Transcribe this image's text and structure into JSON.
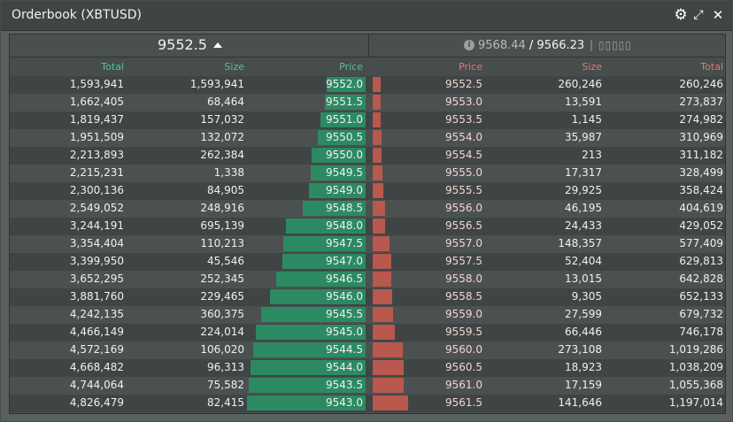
{
  "window": {
    "title": "Orderbook (XBTUSD)"
  },
  "header": {
    "last_price": "9552.5",
    "mark_price": "9568.44",
    "separator": " / ",
    "index_price": "9566.23",
    "funding_placeholder": "| ▯▯▯▯▯"
  },
  "columns": {
    "bid_total": "Total",
    "bid_size": "Size",
    "bid_price": "Price",
    "ask_price": "Price",
    "ask_size": "Size",
    "ask_total": "Total"
  },
  "colors": {
    "bid": "#2c8a62",
    "ask": "#b9584d",
    "bid_text": "#53c48f",
    "ask_text": "#e07a6e"
  },
  "max_total": 4826479,
  "rows": [
    {
      "bid_total": "1,593,941",
      "bid_size": "1,593,941",
      "bid_price": "9552.0",
      "ask_price": "9552.5",
      "ask_size": "260,246",
      "ask_total": "260,246"
    },
    {
      "bid_total": "1,662,405",
      "bid_size": "68,464",
      "bid_price": "9551.5",
      "ask_price": "9553.0",
      "ask_size": "13,591",
      "ask_total": "273,837"
    },
    {
      "bid_total": "1,819,437",
      "bid_size": "157,032",
      "bid_price": "9551.0",
      "ask_price": "9553.5",
      "ask_size": "1,145",
      "ask_total": "274,982"
    },
    {
      "bid_total": "1,951,509",
      "bid_size": "132,072",
      "bid_price": "9550.5",
      "ask_price": "9554.0",
      "ask_size": "35,987",
      "ask_total": "310,969"
    },
    {
      "bid_total": "2,213,893",
      "bid_size": "262,384",
      "bid_price": "9550.0",
      "ask_price": "9554.5",
      "ask_size": "213",
      "ask_total": "311,182"
    },
    {
      "bid_total": "2,215,231",
      "bid_size": "1,338",
      "bid_price": "9549.5",
      "ask_price": "9555.0",
      "ask_size": "17,317",
      "ask_total": "328,499"
    },
    {
      "bid_total": "2,300,136",
      "bid_size": "84,905",
      "bid_price": "9549.0",
      "ask_price": "9555.5",
      "ask_size": "29,925",
      "ask_total": "358,424"
    },
    {
      "bid_total": "2,549,052",
      "bid_size": "248,916",
      "bid_price": "9548.5",
      "ask_price": "9556.0",
      "ask_size": "46,195",
      "ask_total": "404,619"
    },
    {
      "bid_total": "3,244,191",
      "bid_size": "695,139",
      "bid_price": "9548.0",
      "ask_price": "9556.5",
      "ask_size": "24,433",
      "ask_total": "429,052"
    },
    {
      "bid_total": "3,354,404",
      "bid_size": "110,213",
      "bid_price": "9547.5",
      "ask_price": "9557.0",
      "ask_size": "148,357",
      "ask_total": "577,409"
    },
    {
      "bid_total": "3,399,950",
      "bid_size": "45,546",
      "bid_price": "9547.0",
      "ask_price": "9557.5",
      "ask_size": "52,404",
      "ask_total": "629,813"
    },
    {
      "bid_total": "3,652,295",
      "bid_size": "252,345",
      "bid_price": "9546.5",
      "ask_price": "9558.0",
      "ask_size": "13,015",
      "ask_total": "642,828"
    },
    {
      "bid_total": "3,881,760",
      "bid_size": "229,465",
      "bid_price": "9546.0",
      "ask_price": "9558.5",
      "ask_size": "9,305",
      "ask_total": "652,133"
    },
    {
      "bid_total": "4,242,135",
      "bid_size": "360,375",
      "bid_price": "9545.5",
      "ask_price": "9559.0",
      "ask_size": "27,599",
      "ask_total": "679,732"
    },
    {
      "bid_total": "4,466,149",
      "bid_size": "224,014",
      "bid_price": "9545.0",
      "ask_price": "9559.5",
      "ask_size": "66,446",
      "ask_total": "746,178"
    },
    {
      "bid_total": "4,572,169",
      "bid_size": "106,020",
      "bid_price": "9544.5",
      "ask_price": "9560.0",
      "ask_size": "273,108",
      "ask_total": "1,019,286"
    },
    {
      "bid_total": "4,668,482",
      "bid_size": "96,313",
      "bid_price": "9544.0",
      "ask_price": "9560.5",
      "ask_size": "18,923",
      "ask_total": "1,038,209"
    },
    {
      "bid_total": "4,744,064",
      "bid_size": "75,582",
      "bid_price": "9543.5",
      "ask_price": "9561.0",
      "ask_size": "17,159",
      "ask_total": "1,055,368"
    },
    {
      "bid_total": "4,826,479",
      "bid_size": "82,415",
      "bid_price": "9543.0",
      "ask_price": "9561.5",
      "ask_size": "141,646",
      "ask_total": "1,197,014"
    }
  ]
}
